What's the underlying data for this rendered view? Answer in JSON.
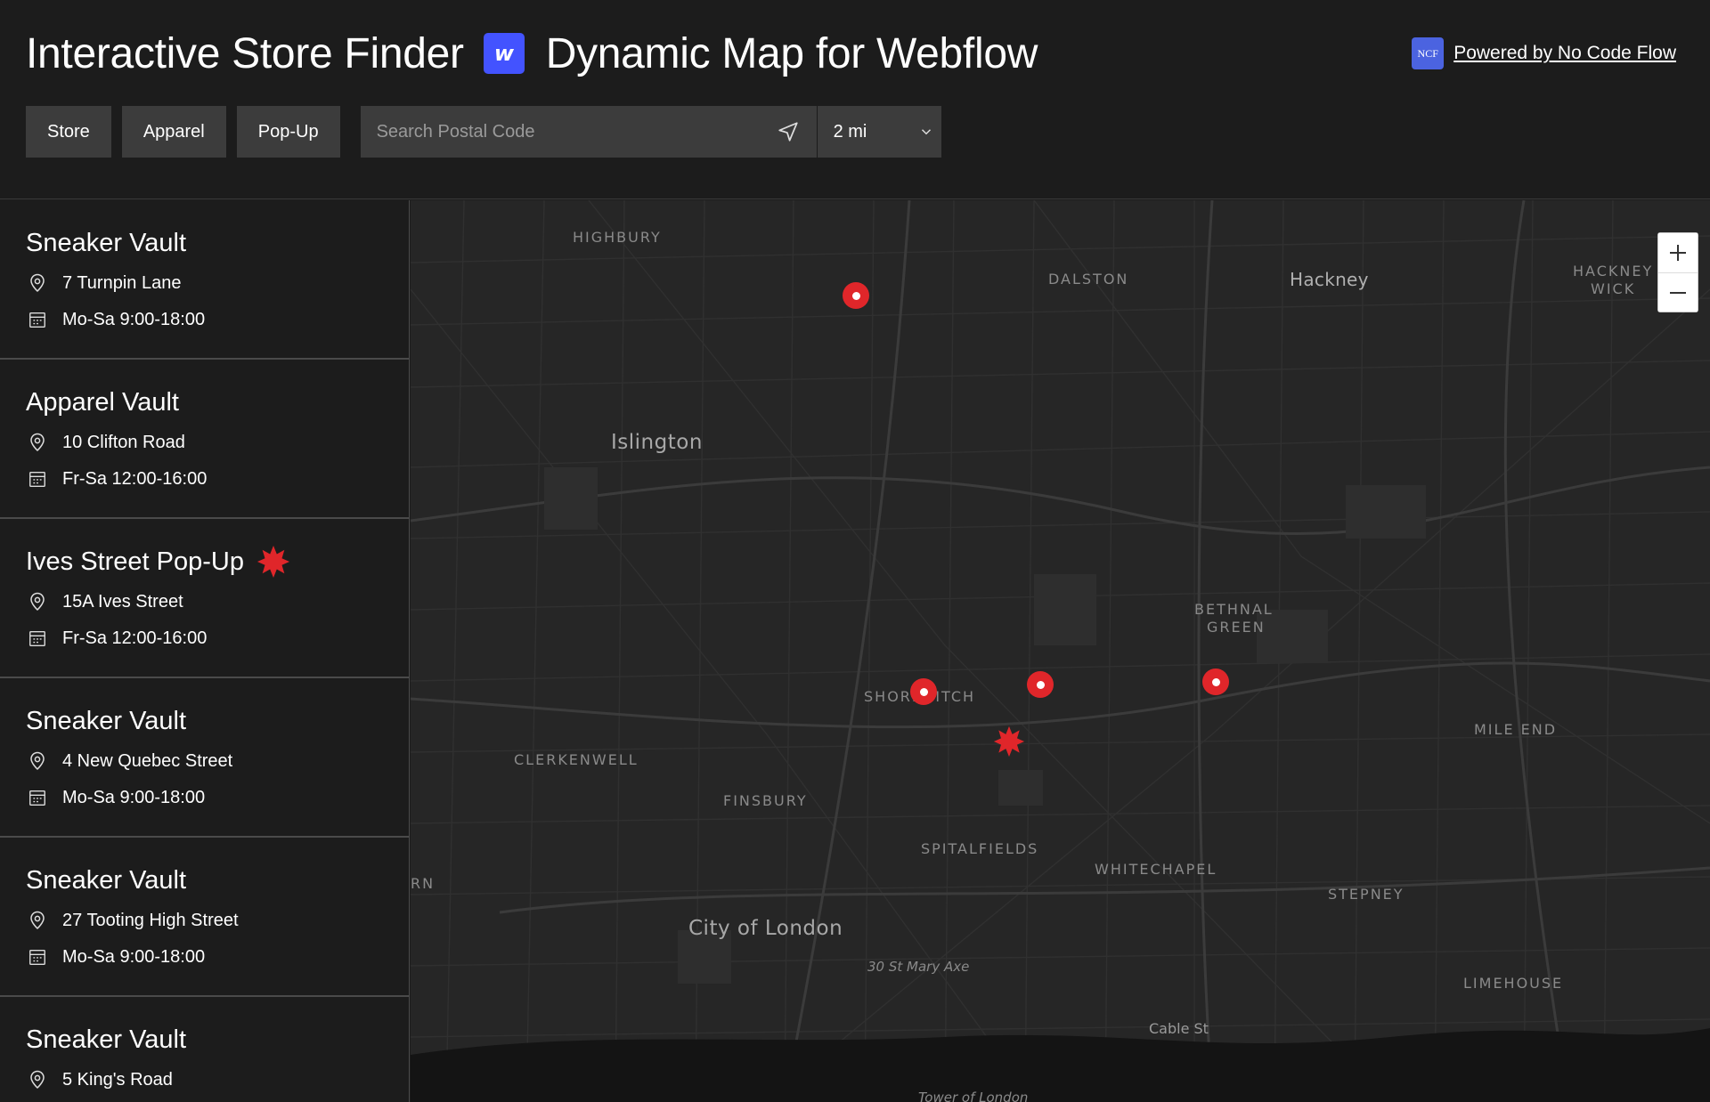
{
  "header": {
    "title_left": "Interactive Store Finder",
    "title_right": "Dynamic Map for Webflow",
    "webflow_logo_letter": "w",
    "powered_logo_text": "NCF",
    "powered_link": "Powered by No Code Flow"
  },
  "filters": [
    "Store",
    "Apparel",
    "Pop-Up"
  ],
  "search": {
    "placeholder": "Search Postal Code",
    "radius": "2 mi"
  },
  "stores": [
    {
      "name": "Sneaker Vault",
      "address": "7 Turnpin Lane",
      "hours": "Mo-Sa 9:00-18:00",
      "popup": false
    },
    {
      "name": "Apparel Vault",
      "address": "10 Clifton Road",
      "hours": "Fr-Sa 12:00-16:00",
      "popup": false
    },
    {
      "name": "Ives Street Pop-Up",
      "address": "15A Ives Street",
      "hours": "Fr-Sa 12:00-16:00",
      "popup": true
    },
    {
      "name": "Sneaker Vault",
      "address": "4 New Quebec Street",
      "hours": "Mo-Sa 9:00-18:00",
      "popup": false
    },
    {
      "name": "Sneaker Vault",
      "address": "27 Tooting High Street",
      "hours": "Mo-Sa 9:00-18:00",
      "popup": false
    },
    {
      "name": "Sneaker Vault",
      "address": "5 King's Road",
      "hours": "",
      "popup": false
    }
  ],
  "map": {
    "labels": {
      "highbury": "HIGHBURY",
      "dalston": "DALSTON",
      "hackney": "Hackney",
      "hackney_wick_1": "HACKNEY",
      "hackney_wick_2": "WICK",
      "islington": "Islington",
      "bethnal_1": "BETHNAL",
      "bethnal_2": "GREEN",
      "shoreditch": "SHOREDITCH",
      "clerkenwell": "CLERKENWELL",
      "finsbury": "FINSBURY",
      "spitalfields": "SPITALFIELDS",
      "whitechapel": "WHITECHAPEL",
      "stepney": "STEPNEY",
      "mile_end": "MILE END",
      "city": "City of London",
      "st_mary_axe": "30 St Mary Axe",
      "cable_st": "Cable St",
      "limehouse": "LIMEHOUSE",
      "tower": "Tower of London",
      "edge_rn": "RN"
    },
    "zoom_in": "+",
    "zoom_out": "−",
    "accent_color": "#e0262a"
  }
}
